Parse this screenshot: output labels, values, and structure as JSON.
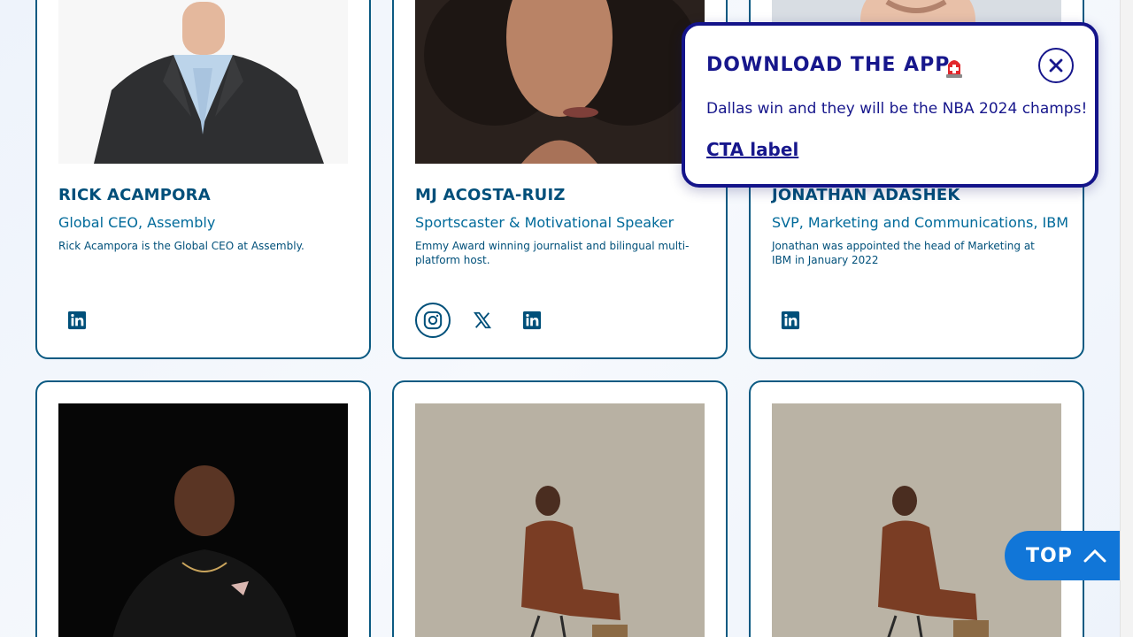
{
  "speakers": [
    {
      "name": "RICK ACAMPORA",
      "role": "Global CEO, Assembly",
      "bio": "Rick Acampora is the Global CEO at Assembly.",
      "socials": [
        "linkedin-icon"
      ]
    },
    {
      "name": "MJ ACOSTA-RUIZ",
      "role": "Sportscaster & Motivational Speaker",
      "bio": "Emmy Award winning journalist and bilingual multi-platform host.",
      "socials": [
        "instagram-icon",
        "x-icon",
        "linkedin-icon"
      ]
    },
    {
      "name": "JONATHAN ADASHEK",
      "role": "SVP, Marketing and Communications, IBM",
      "bio": "Jonathan was appointed the head of Marketing at IBM in January 2022",
      "socials": [
        "linkedin-icon"
      ]
    }
  ],
  "popup": {
    "title": "DOWNLOAD THE APP",
    "message": "Dallas win and they will be the NBA 2024 champs!",
    "cta_label": "CTA label"
  },
  "top_button": {
    "label": "TOP"
  },
  "colors": {
    "navy": "#17178c",
    "teal_text": "#00507a",
    "border": "#0b5a82",
    "top_button": "#1176d8"
  }
}
